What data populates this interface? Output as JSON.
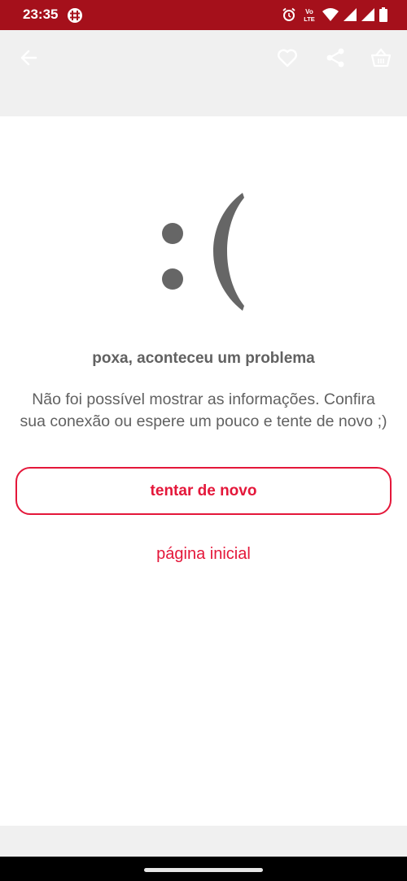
{
  "status_bar": {
    "time": "23:35",
    "volte_label": "Vo LTE",
    "icons": [
      "app-notification-icon",
      "alarm-icon",
      "volte-icon",
      "wifi-icon",
      "signal-icon",
      "signal-icon",
      "battery-icon"
    ]
  },
  "toolbar": {
    "icons": [
      "back-arrow-icon",
      "heart-icon",
      "share-icon",
      "basket-icon"
    ]
  },
  "error": {
    "emoticon": ":(",
    "headline": "poxa, aconteceu um problema",
    "message_line1": "Não foi possível mostrar as informações. Confira",
    "message_line2": "sua conexão ou espere um pouco e tente de novo ;)"
  },
  "actions": {
    "retry_label": "tentar de novo",
    "home_label": "página inicial"
  },
  "colors": {
    "status_bar": "#a5101b",
    "accent": "#e4173a",
    "text_gray": "#616161",
    "toolbar_bg": "#f0f0f0"
  }
}
